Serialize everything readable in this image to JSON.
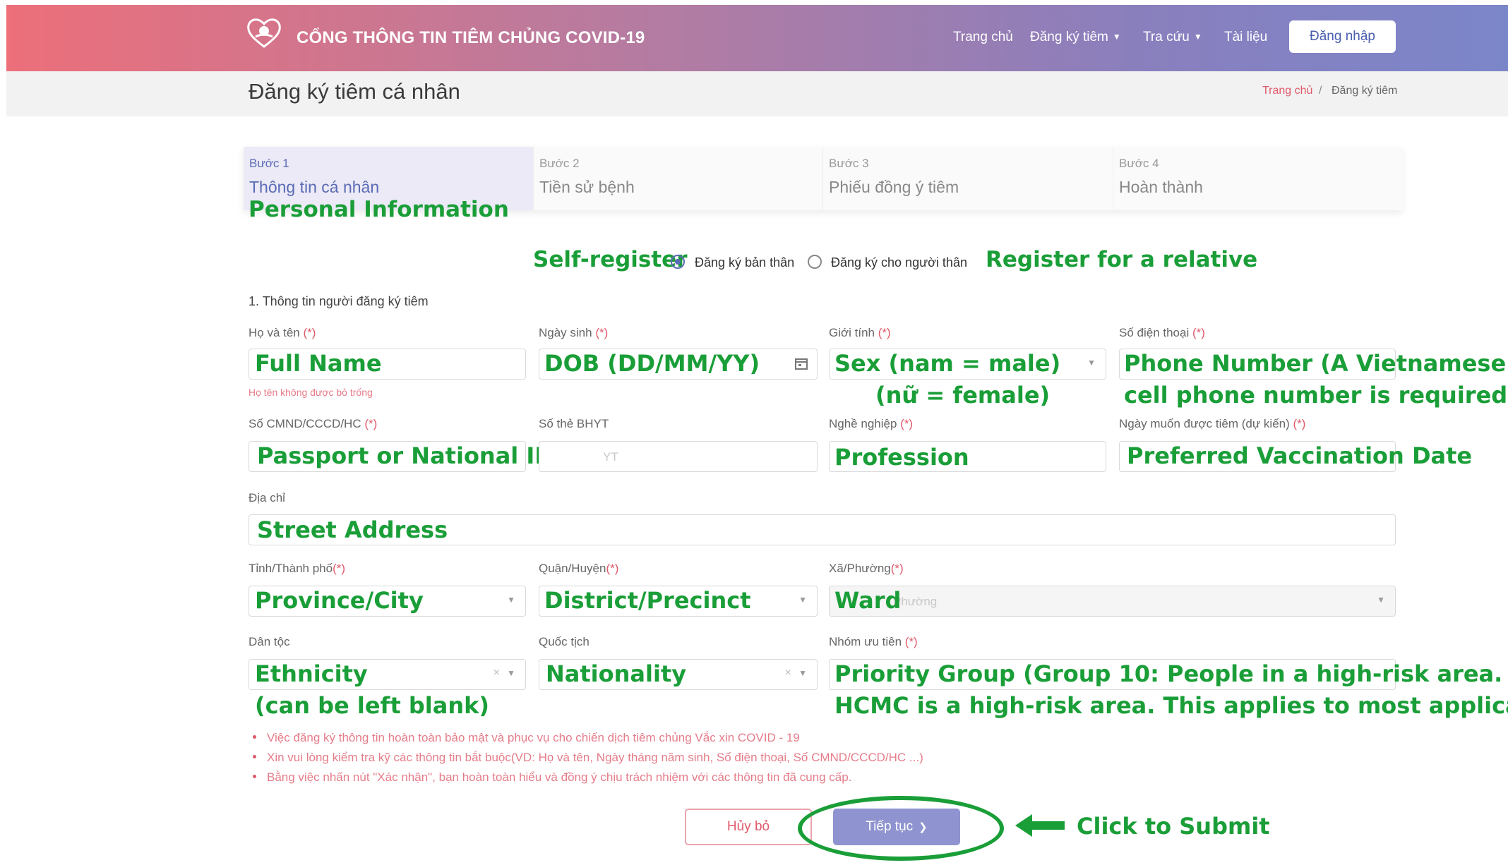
{
  "header": {
    "site_title": "CỔNG THÔNG TIN TIÊM CHỦNG COVID-19",
    "nav": [
      {
        "label": "Trang chủ"
      },
      {
        "label": "Đăng ký tiêm"
      },
      {
        "label": "Tra cứu"
      },
      {
        "label": "Tài liệu"
      }
    ],
    "login_label": "Đăng nhập"
  },
  "subheader": {
    "title": "Đăng ký tiêm cá nhân",
    "breadcrumb_home": "Trang chủ",
    "breadcrumb_sep": "/",
    "breadcrumb_current": "Đăng ký tiêm"
  },
  "steps": [
    {
      "num": "Bước 1",
      "name": "Thông tin cá nhân"
    },
    {
      "num": "Bước 2",
      "name": "Tiền sử bệnh"
    },
    {
      "num": "Bước 3",
      "name": "Phiếu đồng ý tiêm"
    },
    {
      "num": "Bước 4",
      "name": "Hoàn thành"
    }
  ],
  "annotations": {
    "personal_info": "Personal Information",
    "self_register": "Self-register",
    "register_relative": "Register for a relative",
    "full_name": "Full Name",
    "dob": "DOB (DD/MM/YY)",
    "sex_line1": "Sex (nam = male)",
    "sex_line2": "(nữ = female)",
    "phone_line1": "Phone Number (A Vietnamese",
    "phone_line2": "cell phone number is required)",
    "id_number": "Passport or National ID Number",
    "profession": "Profession",
    "preferred_date": "Preferred Vaccination Date",
    "street": "Street Address",
    "province": "Province/City",
    "district": "District/Precinct",
    "ward": "Ward",
    "ethnicity_line1": "Ethnicity",
    "ethnicity_line2": "(can be left blank)",
    "nationality": "Nationality",
    "priority_line1": "Priority Group (Group 10: People in a high-risk area.",
    "priority_line2": "HCMC is a high-risk area. This applies to most applicants.)",
    "submit": "Click to Submit",
    "color": "#1a9e38"
  },
  "form": {
    "radio_self": "Đăng ký bản thân",
    "radio_relative": "Đăng ký cho người thân",
    "radio_selected": "self",
    "section_title": "1. Thông tin người đăng ký tiêm",
    "labels": {
      "name": "Họ và tên",
      "dob": "Ngày sinh",
      "sex": "Giới tính",
      "phone": "Số điện thoại",
      "id": "Số CMND/CCCD/HC",
      "insurance": "Số thẻ BHYT",
      "job": "Nghề nghiệp",
      "date": "Ngày muốn được tiêm (dự kiến)",
      "address": "Địa chỉ",
      "province": "Tỉnh/Thành phố",
      "district": "Quận/Huyện",
      "ward": "Xã/Phường",
      "ethnicity": "Dân tộc",
      "nationality": "Quốc tịch",
      "priority": "Nhóm ưu tiên"
    },
    "required_mark": "(*)",
    "placeholders": {
      "insurance": "YT",
      "ward": "Phường"
    },
    "name_error": "Họ tên không được bỏ trống"
  },
  "notes": [
    "Việc đăng ký thông tin hoàn toàn bảo mật và phục vụ cho chiến dịch tiêm chủng Vắc xin COVID - 19",
    "Xin vui lòng kiểm tra kỹ các thông tin bắt buộc(VD: Họ và tên, Ngày tháng năm sinh, Số điện thoại, Số CMND/CCCD/HC ...)",
    "Bằng việc nhấn nút \"Xác nhận\", bạn hoàn toàn hiểu và đồng ý chịu trách nhiệm với các thông tin đã cung cấp."
  ],
  "buttons": {
    "cancel": "Hủy bỏ",
    "next": "Tiếp tục"
  },
  "colors": {
    "brand": "#7b86c9",
    "accent_red": "#e05a6b",
    "annotation_green": "#1a9e38"
  }
}
